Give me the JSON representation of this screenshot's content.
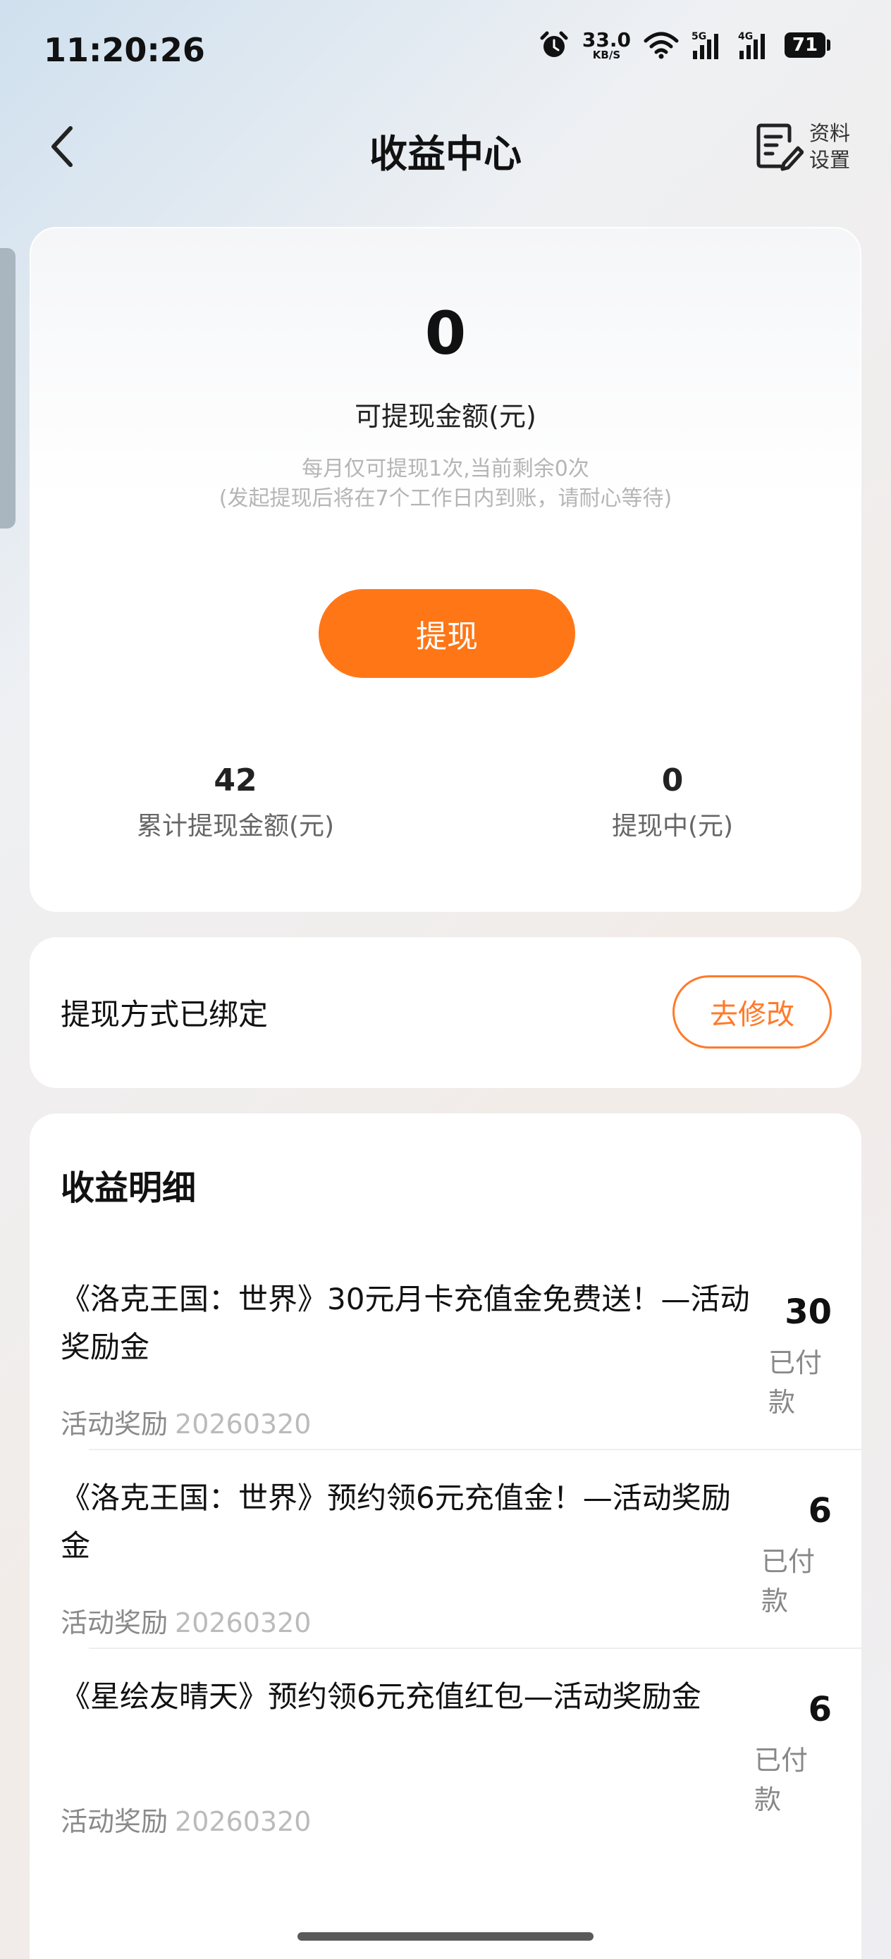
{
  "status_bar": {
    "time": "11:20:26",
    "net_speed_value": "33.0",
    "net_speed_unit": "KB/S",
    "signal_5g_label": "5G",
    "signal_4g_label": "4G",
    "battery": "71",
    "icons": [
      "alarm-icon",
      "wifi-icon",
      "signal-5g-icon",
      "signal-4g-icon",
      "battery-icon"
    ]
  },
  "header": {
    "title": "收益中心",
    "settings_label": "资料设置",
    "back_icon": "back-arrow-icon",
    "settings_icon": "edit-document-icon"
  },
  "balance_card": {
    "amount": "0",
    "amount_label": "可提现金额(元)",
    "note_line1": "每月仅可提现1次,当前剩余0次",
    "note_line2": "(发起提现后将在7个工作日内到账，请耐心等待)",
    "withdraw_button": "提现",
    "stats": [
      {
        "value": "42",
        "label": "累计提现金额(元)"
      },
      {
        "value": "0",
        "label": "提现中(元)"
      }
    ]
  },
  "bind_card": {
    "text": "提现方式已绑定",
    "button": "去修改"
  },
  "details": {
    "title": "收益明细",
    "items": [
      {
        "title": "《洛克王国：世界》30元月卡充值金免费送！—活动奖励金",
        "type": "活动奖励",
        "date": "20260320",
        "amount": "30",
        "status": "已付款"
      },
      {
        "title": "《洛克王国：世界》预约领6元充值金！—活动奖励金",
        "type": "活动奖励",
        "date": "20260320",
        "amount": "6",
        "status": "已付款"
      },
      {
        "title": "《星绘友晴天》预约领6元充值红包—活动奖励金",
        "type": "活动奖励",
        "date": "20260320",
        "amount": "6",
        "status": "已付款"
      }
    ]
  },
  "colors": {
    "accent": "#ff7617",
    "accent_outline": "#ff7a2a",
    "card_bg": "#ffffff",
    "muted_text": "#b5b5b5"
  }
}
